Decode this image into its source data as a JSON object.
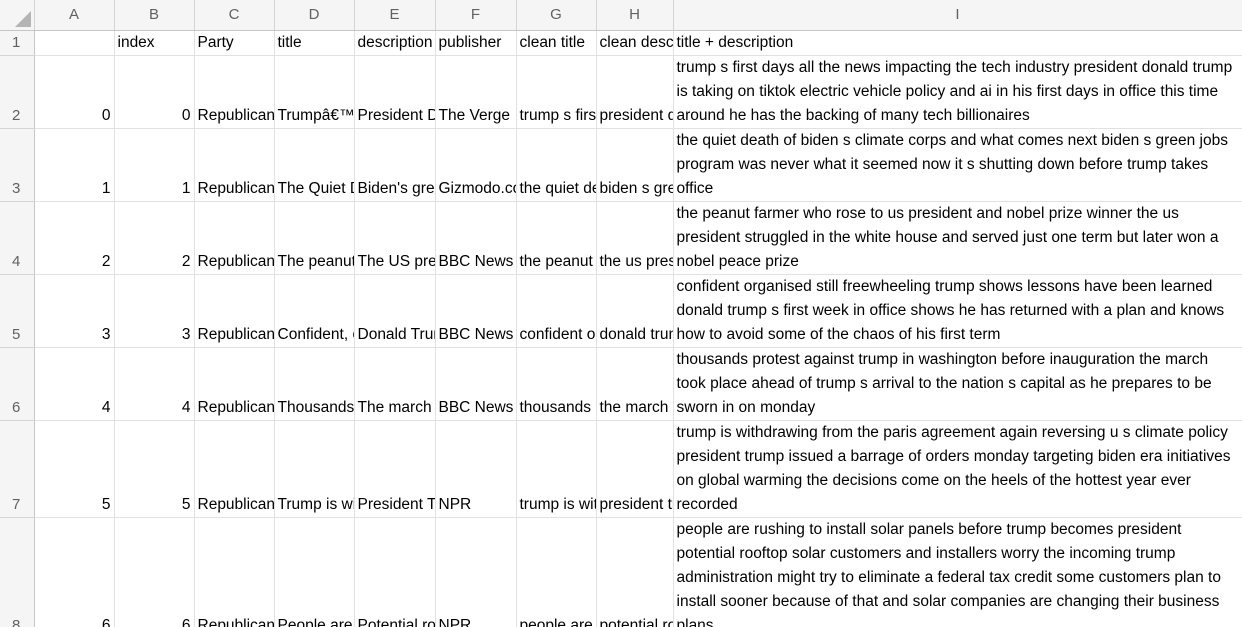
{
  "columns": [
    "A",
    "B",
    "C",
    "D",
    "E",
    "F",
    "G",
    "H",
    "I"
  ],
  "row_numbers": [
    "1",
    "2",
    "3",
    "4",
    "5",
    "6",
    "7",
    "8"
  ],
  "header_row": {
    "A": "",
    "B": "index",
    "C": "Party",
    "D": "title",
    "E": "description",
    "F": "publisher",
    "G": "clean title",
    "H": "clean description",
    "I": "title + description"
  },
  "rows": [
    {
      "A": "0",
      "B": "0",
      "C": "Republican",
      "D": "Trumpâ€™s first days",
      "E": "President Donald",
      "F": "The Verge",
      "G": "trump s first days",
      "H": "president donald",
      "I": "trump s first days all the news impacting the tech industry president donald trump is taking on tiktok electric vehicle policy and ai in his first days in office this time around he has the backing of many tech billionaires"
    },
    {
      "A": "1",
      "B": "1",
      "C": "Republican",
      "D": "The Quiet Death",
      "E": "Biden's green jobs",
      "F": "Gizmodo.com",
      "G": "the quiet death",
      "H": "biden s green jobs",
      "I": "the quiet death of biden s climate corps and what comes next biden s green jobs program was never what it seemed now it s shutting down before trump takes office"
    },
    {
      "A": "2",
      "B": "2",
      "C": "Republican",
      "D": "The peanut farmer",
      "E": "The US president",
      "F": "BBC News",
      "G": "the peanut farmer",
      "H": "the us president",
      "I": "the peanut farmer who rose to us president and nobel prize winner the us president struggled in the white house and served just one term but later won a nobel peace prize"
    },
    {
      "A": "3",
      "B": "3",
      "C": "Republican",
      "D": "Confident, organised",
      "E": "Donald Trump's",
      "F": "BBC News",
      "G": "confident organised",
      "H": "donald trump s",
      "I": "confident organised still freewheeling trump shows lessons have been learned donald trump s first week in office shows he has returned with a plan and knows how to avoid some of the chaos of his first term"
    },
    {
      "A": "4",
      "B": "4",
      "C": "Republican",
      "D": "Thousands protest",
      "E": "The march took",
      "F": "BBC News",
      "G": "thousands protest",
      "H": "the march took",
      "I": "thousands protest against trump in washington before inauguration the march took place ahead of trump s arrival to the nation s capital as he prepares to be sworn in on monday"
    },
    {
      "A": "5",
      "B": "5",
      "C": "Republican",
      "D": "Trump is withdrawing",
      "E": "President Trump",
      "F": "NPR",
      "G": "trump is withdrawing",
      "H": "president trump",
      "I": "trump is withdrawing from the paris agreement again reversing u s climate policy president trump issued a barrage of orders monday targeting biden era initiatives on global warming the decisions come on the heels of the hottest year ever recorded"
    },
    {
      "A": "6",
      "B": "6",
      "C": "Republican",
      "D": "People are rushing",
      "E": "Potential rooftop",
      "F": "NPR",
      "G": "people are rushing",
      "H": "potential rooftop",
      "I": "people are rushing to install solar panels before trump becomes president potential rooftop solar customers and installers worry the incoming trump administration might try to eliminate a federal tax credit some customers plan to install sooner because of that and solar companies are changing their business plans"
    }
  ]
}
